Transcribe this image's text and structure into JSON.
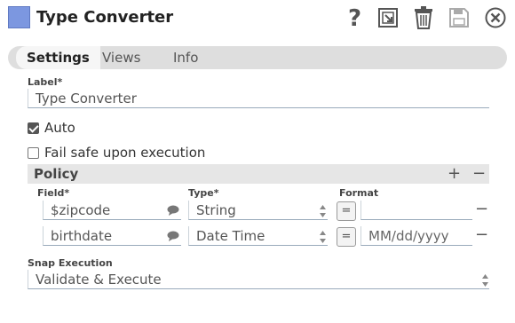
{
  "header": {
    "title": "Type Converter",
    "icons": [
      "help-icon",
      "export-icon",
      "delete-icon",
      "save-icon",
      "close-icon"
    ],
    "app_icon_color": "#7c97e0"
  },
  "tabs": [
    {
      "label": "Settings",
      "active": true
    },
    {
      "label": "Views",
      "active": false
    },
    {
      "label": "Info",
      "active": false
    }
  ],
  "settings": {
    "label_title": "Label*",
    "label_value": "Type Converter",
    "auto_label": "Auto",
    "auto_checked": true,
    "failsafe_label": "Fail safe upon execution",
    "failsafe_checked": false
  },
  "policy": {
    "title": "Policy",
    "add_symbol": "+",
    "remove_symbol": "−",
    "columns": {
      "field": "Field*",
      "type": "Type*",
      "format": "Format"
    },
    "rows": [
      {
        "field": "$zipcode",
        "type": "String",
        "format": "",
        "format_placeholder": "",
        "eq": "=",
        "remove": "−"
      },
      {
        "field": "birthdate",
        "type": "Date Time",
        "format": "",
        "format_placeholder": "MM/dd/yyyy",
        "eq": "=",
        "remove": "−"
      }
    ]
  },
  "snap_execution": {
    "label": "Snap Execution",
    "value": "Validate & Execute"
  }
}
